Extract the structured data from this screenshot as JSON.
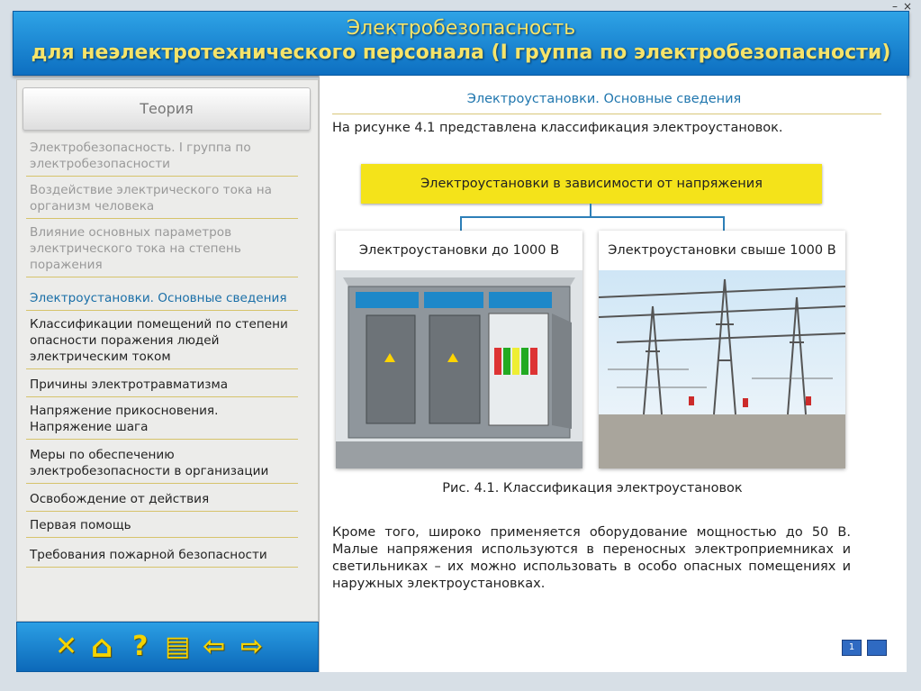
{
  "window": {
    "minimize": "–",
    "close": "×"
  },
  "header": {
    "line1": "Электробезопасность",
    "line2": "для неэлектротехнического персонала (I группа по электробезопасности)"
  },
  "sidebar": {
    "theory_button": "Теория",
    "items": [
      {
        "label": "Электробезопасность. I группа по электробезопасности",
        "state": "visited"
      },
      {
        "label": "Воздействие электрического тока на организм человека",
        "state": "visited"
      },
      {
        "label": "Влияние основных параметров электрического тока на степень поражения",
        "state": "visited"
      },
      {
        "label": "Электроустановки. Основные сведения",
        "state": "active"
      },
      {
        "label": "Классификации помещений по степени опасности поражения людей электрическим током",
        "state": "normal"
      },
      {
        "label": "Причины электротравматизма",
        "state": "normal"
      },
      {
        "label": "Напряжение прикосновения. Напряжение шага",
        "state": "normal"
      },
      {
        "label": "Меры по обеспечению электробезопасности в организации",
        "state": "normal"
      },
      {
        "label": "Освобождение от действия",
        "state": "normal"
      },
      {
        "label": "Первая помощь",
        "state": "normal"
      },
      {
        "label": "Требования пожарной безопасности",
        "state": "normal"
      }
    ]
  },
  "toolbar": {
    "icons": [
      "close-icon",
      "home-icon",
      "help-icon",
      "contents-icon",
      "arrow-left-icon",
      "arrow-right-icon"
    ],
    "glyphs": {
      "close": "✕",
      "home": "⌂",
      "help": "?",
      "contents": "▤",
      "back": "⇦",
      "forward": "⇨"
    },
    "accent": "#f5d300"
  },
  "content": {
    "section_title": "Электроустановки. Основные сведения",
    "intro": "На рисунке 4.1 представлена классификация электроустановок.",
    "diagram": {
      "root": "Электроустановки в зависимости от напряжения",
      "left": "Электроустановки до 1000 В",
      "right": "Электроустановки свыше 1000 В"
    },
    "caption": "Рис. 4.1. Классификация электроустановок",
    "paragraph": "Кроме того, широко применяется оборудование мощностью до 50 В. Малые напряжения используются в переносных электроприемниках и светильниках – их можно использовать в особо опасных помещениях и наружных электроустановках.",
    "page_buttons": [
      "1",
      ""
    ]
  }
}
